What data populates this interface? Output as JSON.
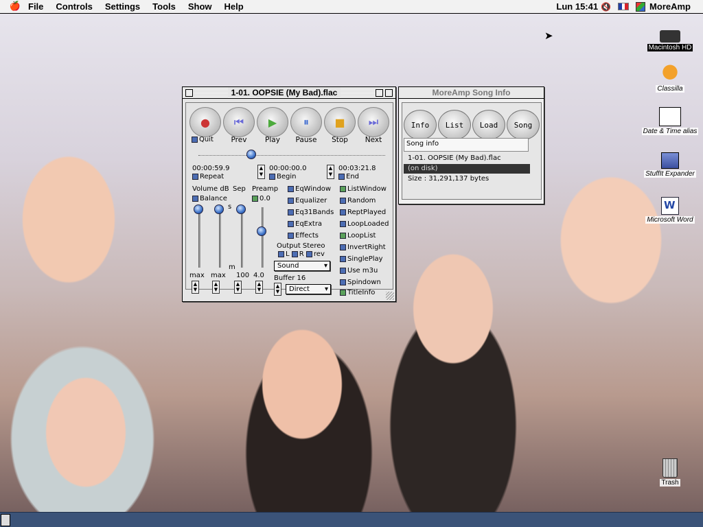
{
  "menubar": {
    "apple_icon": "apple-icon",
    "items": [
      "File",
      "Controls",
      "Settings",
      "Tools",
      "Show",
      "Help"
    ],
    "clock": "Lun 15:41",
    "app_name": "MoreAmp",
    "flag_colors": [
      "#1f3fa6",
      "#ffffff",
      "#d8232a"
    ]
  },
  "desktop": {
    "icons": [
      {
        "label": "Macintosh HD",
        "icon": "hard-disk-icon"
      },
      {
        "label": "Classilla",
        "icon": "dinosaur-icon"
      },
      {
        "label": "Date & Time alias",
        "icon": "clock-calendar-icon"
      },
      {
        "label": "StuffIt Expander",
        "icon": "stuffit-icon"
      },
      {
        "label": "Microsoft Word",
        "icon": "word-icon"
      },
      {
        "label": "Trash",
        "icon": "trash-icon"
      }
    ]
  },
  "player": {
    "title": "1-01. OOPSIE (My Bad).flac",
    "transport": [
      "Quit",
      "Prev",
      "Play",
      "Pause",
      "Stop",
      "Next"
    ],
    "time_current": "00:00:59.9",
    "time_begin": "00:00:00.0",
    "time_end": "00:03:21.8",
    "repeat_label": "Repeat",
    "begin_label": "Begin",
    "end_label": "End",
    "volume_label": "Volume dB",
    "sep_label": "Sep",
    "preamp_label": "Preamp",
    "preamp_value": "0.0",
    "balance_label": "Balance",
    "s_mark": "s",
    "m_mark": "m",
    "bottom_vals": [
      "max",
      "max",
      "100",
      "4.0"
    ],
    "mid_options": [
      "EqWindow",
      "Equalizer",
      "Eq31Bands",
      "EqExtra",
      "Effects"
    ],
    "output_label": "Output Stereo",
    "output_opts": [
      "L",
      "R",
      "rev"
    ],
    "sound_popup": "Sound",
    "buffer_label": "Buffer 16",
    "direct_popup": "Direct",
    "right_options": [
      "ListWindow",
      "Random",
      "ReptPlayed",
      "LoopLoaded",
      "LoopList",
      "InvertRight",
      "SinglePlay",
      "Use m3u",
      "Spindown",
      "TitleInfo"
    ]
  },
  "songinfo": {
    "title": "MoreAmp Song Info",
    "buttons": [
      "Info",
      "List",
      "Load",
      "Song"
    ],
    "header": "Song info",
    "filename": "1-01. OOPSIE (My Bad).flac",
    "status": "(on disk)",
    "size": "Size : 31,291,137 bytes"
  }
}
